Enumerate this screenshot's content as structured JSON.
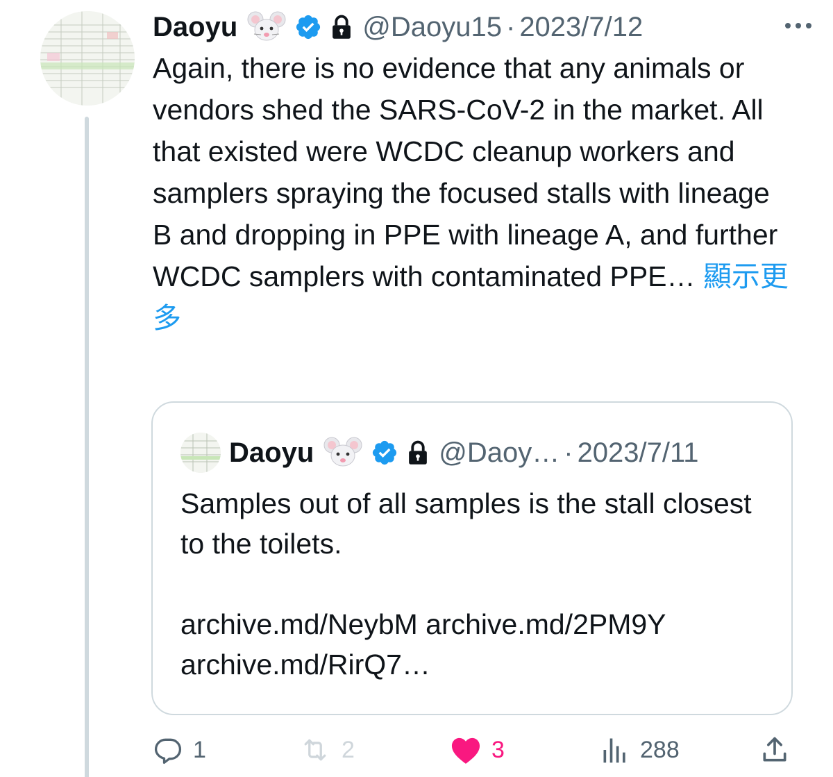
{
  "tweet": {
    "author_name": "Daoyu",
    "author_emoji": "🐭",
    "verified_icon": "verified-badge-icon",
    "lock_icon": "lock-icon",
    "handle": "@Daoyu15",
    "separator": "·",
    "date": "2023/7/12",
    "text": "Again, there is no evidence that any animals or vendors shed the SARS-CoV-2 in the market. All that existed were WCDC cleanup workers and samplers spraying the focused stalls with lineage B and dropping in PPE with lineage A, and further WCDC samplers with contaminated PPE…",
    "show_more": "顯示更多"
  },
  "quoted": {
    "author_name": "Daoyu",
    "author_emoji": "🐭",
    "handle": "@Daoy…",
    "separator": "·",
    "date": "2023/7/11",
    "line1": "Samples out of all samples is the stall closest to the toilets.",
    "line2": "archive.md/NeybM archive.md/2PM9Y archive.md/RirQ7…"
  },
  "actions": {
    "reply_count": "1",
    "retweet_count": "2",
    "like_count": "3",
    "views_count": "288"
  },
  "colors": {
    "accent": "#1d9bf0",
    "like": "#f91880",
    "muted": "#536471",
    "border": "#cfd9de"
  }
}
